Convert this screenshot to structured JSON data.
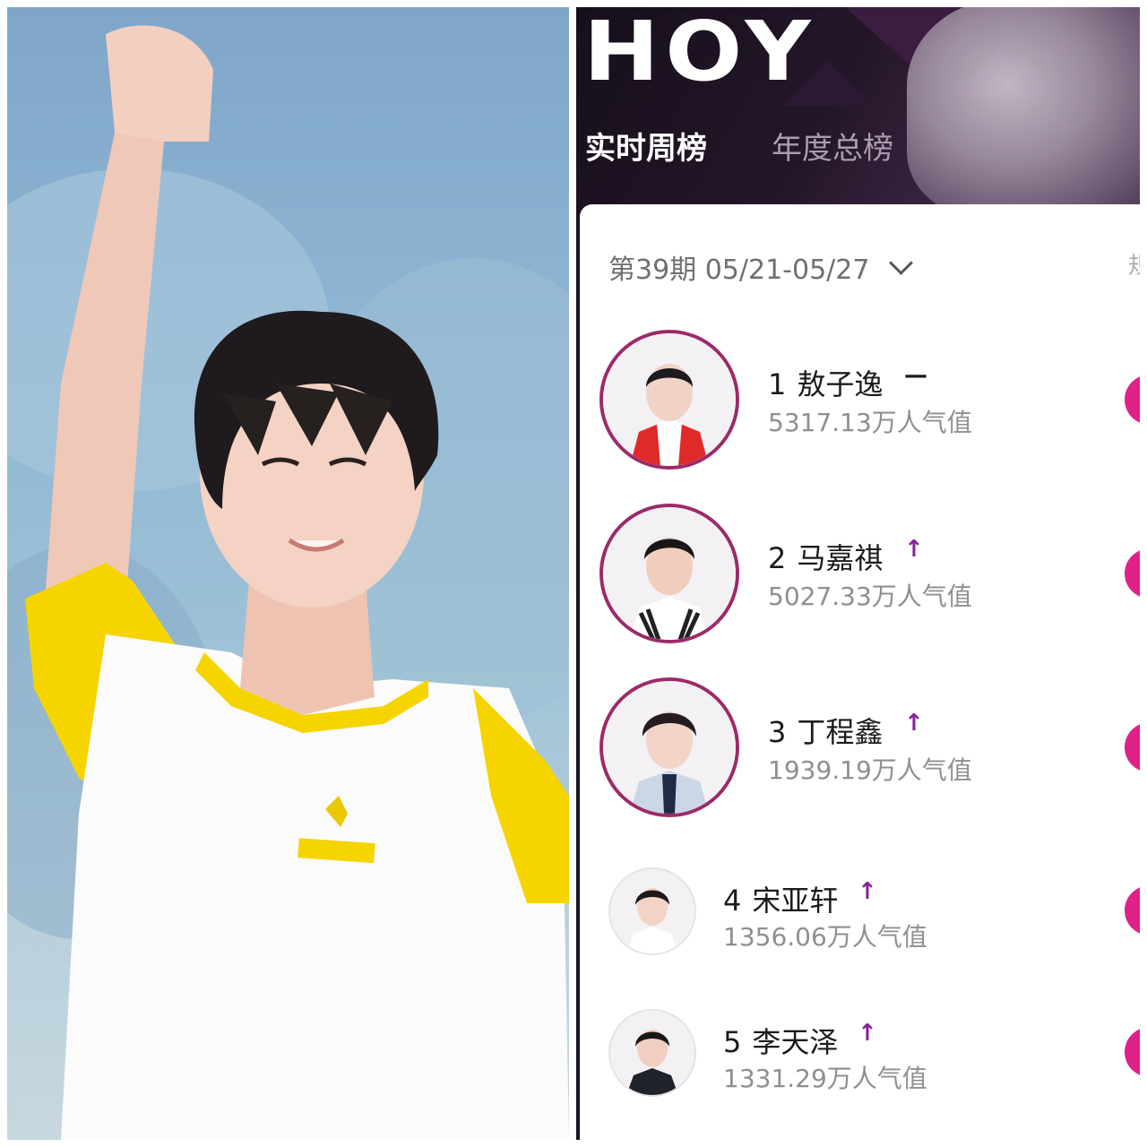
{
  "colors": {
    "accent": "#e0218a",
    "ring": "#9c2a68",
    "trend_up": "#8a1f9a",
    "header_bg": "#1a1220",
    "shirt_yellow": "#f6d400"
  },
  "header": {
    "logo": "HOY",
    "tabs": [
      {
        "label": "实时周榜",
        "active": true
      },
      {
        "label": "年度总榜",
        "active": false
      }
    ]
  },
  "period": {
    "label": "第39期 05/21-05/27",
    "dropdown_icon": "chevron-down-icon"
  },
  "ranking": [
    {
      "rank": "1",
      "name": "敖子逸",
      "trend": "—",
      "trend_type": "same",
      "popularity": "5317.13万人气值"
    },
    {
      "rank": "2",
      "name": "马嘉祺",
      "trend": "↑",
      "trend_type": "up",
      "popularity": "5027.33万人气值"
    },
    {
      "rank": "3",
      "name": "丁程鑫",
      "trend": "↑",
      "trend_type": "up",
      "popularity": "1939.19万人气值"
    },
    {
      "rank": "4",
      "name": "宋亚轩",
      "trend": "↑",
      "trend_type": "up",
      "popularity": "1356.06万人气值"
    },
    {
      "rank": "5",
      "name": "李天泽",
      "trend": "↑",
      "trend_type": "up",
      "popularity": "1331.29万人气值"
    }
  ]
}
